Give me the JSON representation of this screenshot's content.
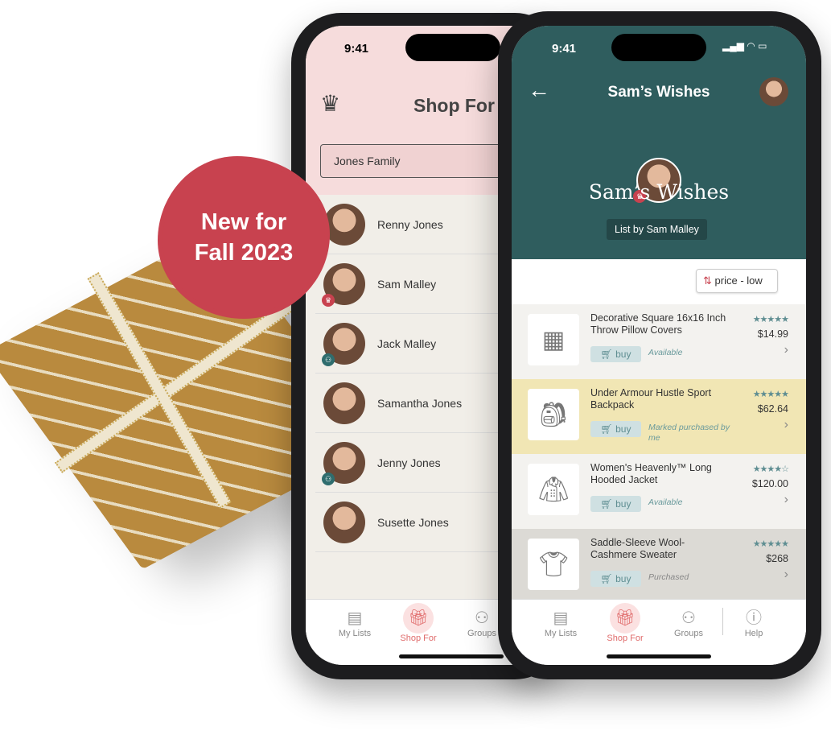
{
  "badge": {
    "text_line1": "New for",
    "text_line2": "Fall 2023"
  },
  "left_phone": {
    "time": "9:41",
    "title": "Shop For",
    "group_select": "Jones Family",
    "people": [
      {
        "name": "Renny Jones"
      },
      {
        "name": "Sam Malley",
        "badge": "crown"
      },
      {
        "name": "Jack Malley",
        "badge": "group"
      },
      {
        "name": "Samantha Jones"
      },
      {
        "name": "Jenny Jones",
        "badge": "group"
      },
      {
        "name": "Susette Jones"
      }
    ],
    "tabs": [
      {
        "label": "My Lists",
        "icon": "list-icon"
      },
      {
        "label": "Shop For",
        "icon": "gift-icon",
        "active": true
      },
      {
        "label": "Groups",
        "icon": "groups-icon"
      }
    ]
  },
  "right_phone": {
    "time": "9:41",
    "title": "Sam’s Wishes",
    "list_title": "Sam’s Wishes",
    "list_by": "List by Sam Malley",
    "sort_label": "price - low",
    "items": [
      {
        "name": "Decorative Square 16x16 Inch Throw Pillow Covers",
        "stars": "★★★★★",
        "price": "$14.99",
        "buy": "buy",
        "status": "Available",
        "bg": "#f3f2ef"
      },
      {
        "name": "Under Armour Hustle Sport Backpack",
        "stars": "★★★★★",
        "price": "$62.64",
        "buy": "buy",
        "status": "Marked purchased by me",
        "bg": "#f1e6b4"
      },
      {
        "name": "Women's Heavenly™ Long Hooded Jacket",
        "stars": "★★★★☆",
        "price": "$120.00",
        "buy": "buy",
        "status": "Available",
        "bg": "#f3f2ef"
      },
      {
        "name": "Saddle-Sleeve Wool-Cashmere Sweater",
        "stars": "★★★★★",
        "price": "$268",
        "buy": "buy",
        "status": "Purchased",
        "bg": "#dcdad5"
      }
    ],
    "tabs": [
      {
        "label": "My Lists",
        "icon": "list-icon"
      },
      {
        "label": "Shop For",
        "icon": "gift-icon",
        "active": true
      },
      {
        "label": "Groups",
        "icon": "groups-icon"
      },
      {
        "label": "Help",
        "icon": "help-icon"
      }
    ]
  },
  "colors": {
    "accent": "#e06c6c",
    "teal": "#2f5d5e",
    "badge": "#c8424f"
  }
}
